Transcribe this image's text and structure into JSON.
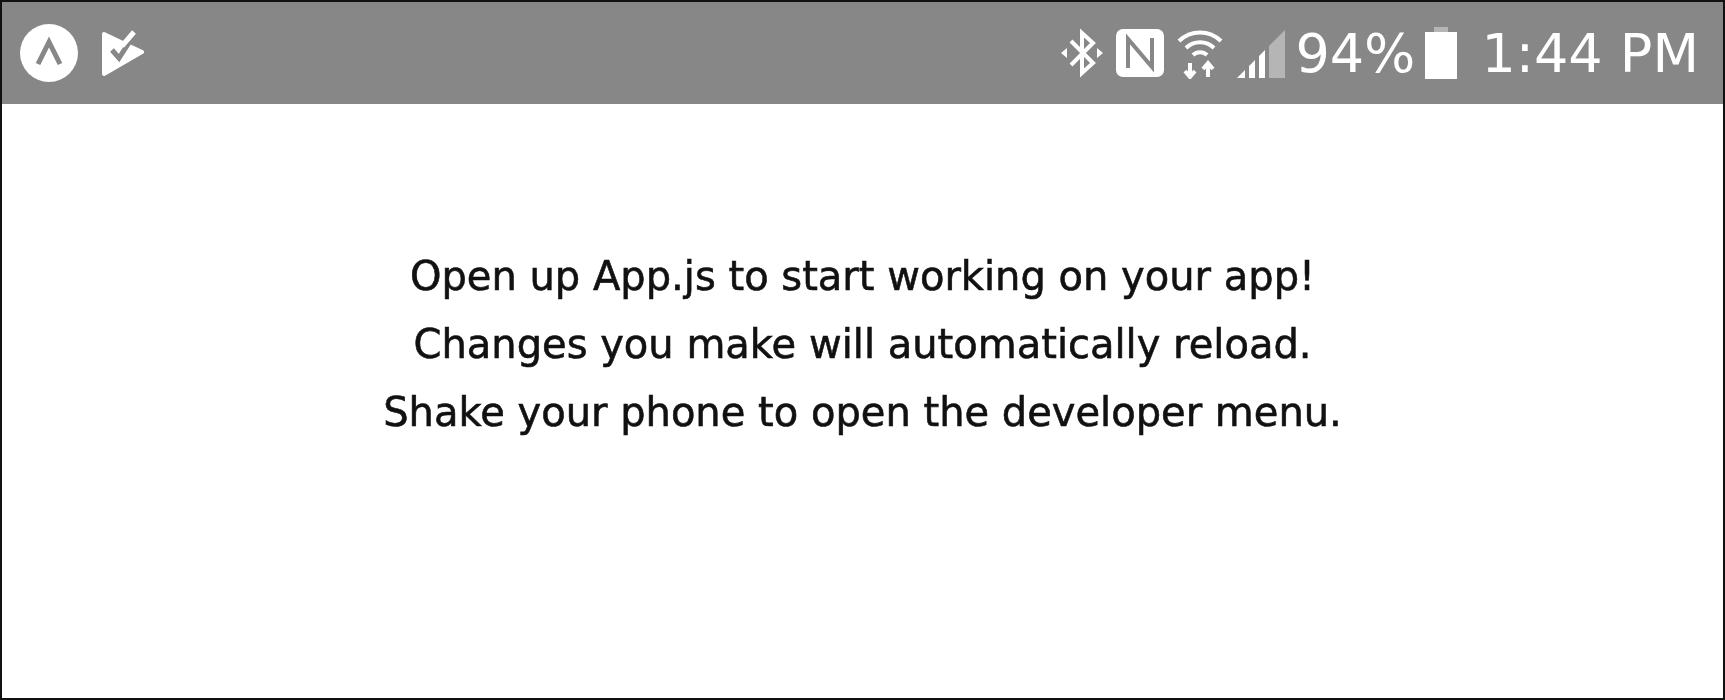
{
  "status_bar": {
    "battery": "94%",
    "time": "1:44 PM"
  },
  "message": {
    "lines": [
      "Open up App.js to start working on your app!",
      "Changes you make will automatically reload.",
      "Shake your phone to open the developer menu."
    ]
  }
}
